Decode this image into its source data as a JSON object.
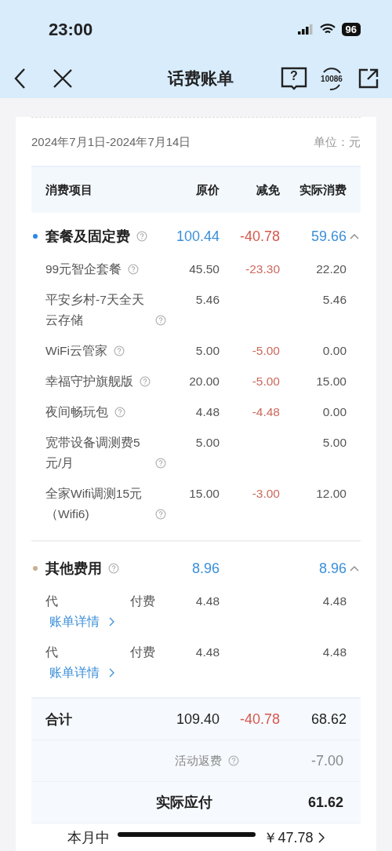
{
  "status_bar": {
    "time": "23:00",
    "battery": "96"
  },
  "nav": {
    "title": "话费账单",
    "help_mark": "?",
    "hotline": "10086"
  },
  "period": {
    "dates": "2024年7月1日-2024年7月14日",
    "unit": "单位：元"
  },
  "table": {
    "columns": [
      "消费项目",
      "原价",
      "减免",
      "实际消费"
    ],
    "groups": [
      {
        "name": "套餐及固定费",
        "color": "#2f86e8",
        "help": true,
        "original": "100.44",
        "discount": "-40.78",
        "actual": "59.66",
        "expanded": true,
        "items": [
          {
            "name": "99元智企套餐",
            "original": "45.50",
            "discount": "-23.30",
            "actual": "22.20"
          },
          {
            "name": "平安乡村-7天全天云存储",
            "original": "5.46",
            "actual": "5.46"
          },
          {
            "name": "WiFi云管家",
            "original": "5.00",
            "discount": "-5.00",
            "actual": "0.00"
          },
          {
            "name": "幸福守护旗舰版",
            "original": "20.00",
            "discount": "-5.00",
            "actual": "15.00"
          },
          {
            "name": "夜间畅玩包",
            "original": "4.48",
            "discount": "-4.48",
            "actual": "0.00"
          },
          {
            "name": "宽带设备调测费5元/月",
            "original": "5.00",
            "actual": "5.00"
          },
          {
            "name": "全家Wifi调测15元（Wifi6)",
            "original": "15.00",
            "discount": "-3.00",
            "actual": "12.00"
          }
        ]
      },
      {
        "name": "其他费用",
        "color": "#c9b08e",
        "help": true,
        "original": "8.96",
        "actual": "8.96",
        "expanded": true,
        "items": [
          {
            "name_parts": [
              "代",
              "付费"
            ],
            "link": "账单详情",
            "original": "4.48",
            "actual": "4.48"
          },
          {
            "name_parts": [
              "代",
              "付费"
            ],
            "link": "账单详情",
            "original": "4.48",
            "actual": "4.48"
          }
        ]
      }
    ]
  },
  "totals": {
    "label": "合计",
    "original": "109.40",
    "discount": "-40.78",
    "actual": "68.62",
    "rebate_label": "活动返费",
    "rebate": "-7.00",
    "payable_label": "实际应付",
    "payable": "61.62"
  },
  "savings": [
    "本月中",
    "￥47.78"
  ]
}
